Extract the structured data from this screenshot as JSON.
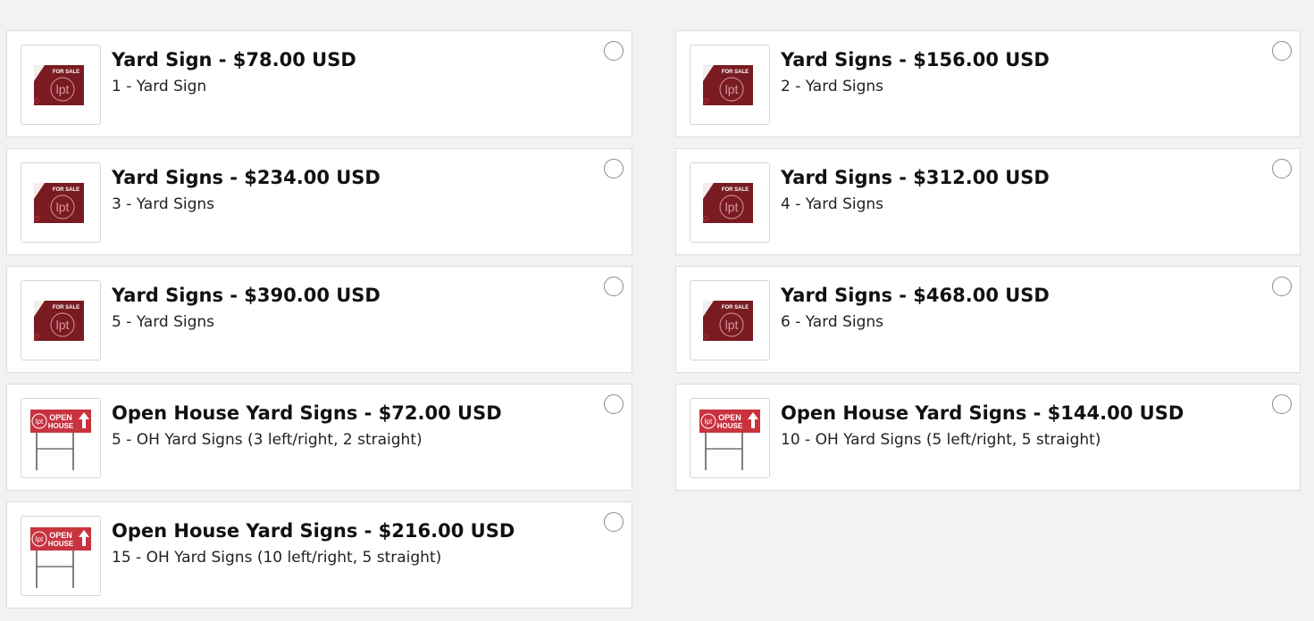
{
  "colors": {
    "sign_maroon": "#7a1b22",
    "open_house_red": "#c8333f",
    "background": "#f2f2f2"
  },
  "options": [
    {
      "title": "Yard Sign - $78.00 USD",
      "subtitle": "1 - Yard Sign",
      "image": "for-sale-sign",
      "sign_text": "FOR SALE",
      "brand": "lpt",
      "selected": false
    },
    {
      "title": "Yard Signs - $156.00 USD",
      "subtitle": "2 - Yard Signs",
      "image": "for-sale-sign",
      "sign_text": "FOR SALE",
      "brand": "lpt",
      "selected": false
    },
    {
      "title": "Yard Signs - $234.00 USD",
      "subtitle": "3 - Yard Signs",
      "image": "for-sale-sign",
      "sign_text": "FOR SALE",
      "brand": "lpt",
      "selected": false
    },
    {
      "title": "Yard Signs - $312.00 USD",
      "subtitle": "4 - Yard Signs",
      "image": "for-sale-sign",
      "sign_text": "FOR SALE",
      "brand": "lpt",
      "selected": false
    },
    {
      "title": "Yard Signs - $390.00 USD",
      "subtitle": "5 - Yard Signs",
      "image": "for-sale-sign",
      "sign_text": "FOR SALE",
      "brand": "lpt",
      "selected": false
    },
    {
      "title": "Yard Signs - $468.00 USD",
      "subtitle": "6 - Yard Signs",
      "image": "for-sale-sign",
      "sign_text": "FOR SALE",
      "brand": "lpt",
      "selected": false
    },
    {
      "title": "Open House Yard Signs - $72.00 USD",
      "subtitle": "5 - OH Yard Signs (3 left/right, 2 straight)",
      "image": "open-house-sign",
      "sign_text_1": "OPEN",
      "sign_text_2": "HOUSE",
      "brand": "lpt",
      "selected": false
    },
    {
      "title": "Open House Yard Signs - $144.00 USD",
      "subtitle": "10 - OH Yard Signs (5 left/right, 5 straight)",
      "image": "open-house-sign",
      "sign_text_1": "OPEN",
      "sign_text_2": "HOUSE",
      "brand": "lpt",
      "selected": false
    },
    {
      "title": "Open House Yard Signs - $216.00 USD",
      "subtitle": "15 - OH Yard Signs (10 left/right, 5 straight)",
      "image": "open-house-sign",
      "sign_text_1": "OPEN",
      "sign_text_2": "HOUSE",
      "brand": "lpt",
      "selected": false
    }
  ]
}
